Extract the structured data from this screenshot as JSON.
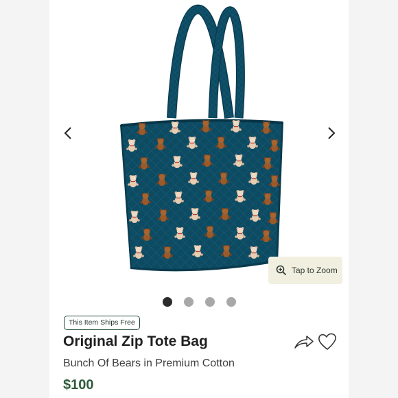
{
  "product": {
    "ships_free_badge": "This Item Ships Free",
    "name": "Original Zip Tote Bag",
    "pattern": "Bunch Of Bears in Premium Cotton",
    "price": "$100"
  },
  "gallery": {
    "zoom_label": "Tap to Zoom",
    "image_count": 4,
    "active_index": 0
  },
  "colors": {
    "bag_teal": "#0d4b63",
    "bear_brown": "#9a5a2a",
    "price_green": "#2e5b3b",
    "zoom_bg": "#f1efe0"
  },
  "icons": [
    "chevron-left-icon",
    "chevron-right-icon",
    "zoom-icon",
    "share-icon",
    "heart-icon"
  ]
}
